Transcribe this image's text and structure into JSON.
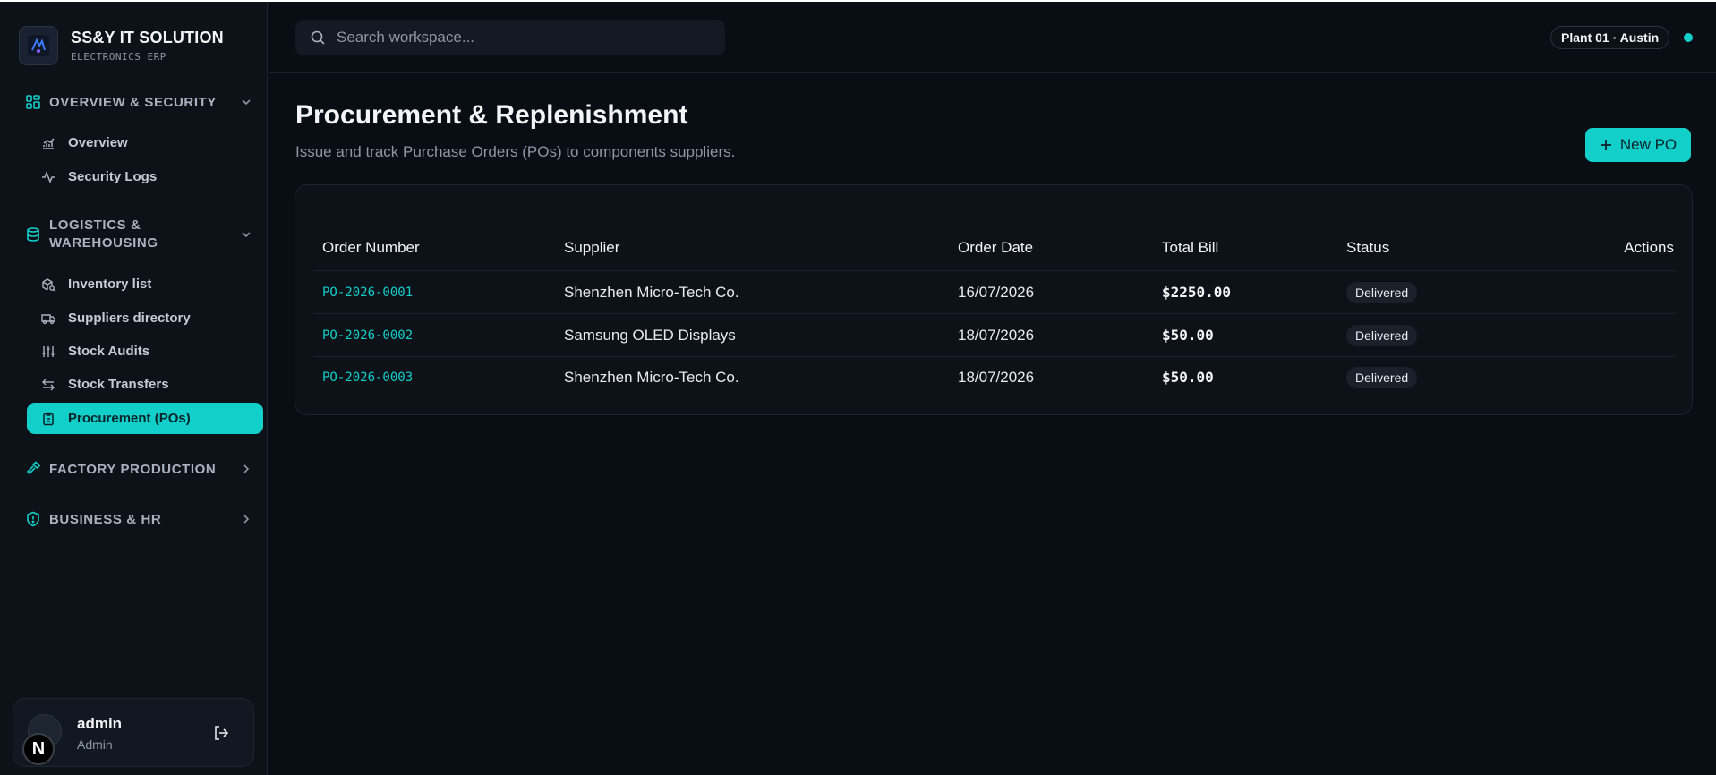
{
  "brand": {
    "title": "SS&Y IT SOLUTION",
    "subtitle": "ELECTRONICS ERP"
  },
  "sidebar": {
    "sections": [
      {
        "label": "OVERVIEW & SECURITY",
        "items": [
          {
            "label": "Overview"
          },
          {
            "label": "Security Logs"
          }
        ]
      },
      {
        "label_line1": "LOGISTICS &",
        "label_line2": "WAREHOUSING",
        "items": [
          {
            "label": "Inventory list"
          },
          {
            "label": "Suppliers directory"
          },
          {
            "label": "Stock Audits"
          },
          {
            "label": "Stock Transfers"
          },
          {
            "label": "Procurement (POs)",
            "active": true
          }
        ]
      },
      {
        "label": "FACTORY PRODUCTION"
      },
      {
        "label": "BUSINESS & HR"
      }
    ]
  },
  "user": {
    "name": "admin",
    "role": "Admin",
    "badge": "N"
  },
  "topbar": {
    "search_placeholder": "Search workspace...",
    "plant": "Plant 01 · Austin"
  },
  "page": {
    "title": "Procurement & Replenishment",
    "subtitle": "Issue and track Purchase Orders (POs) to components suppliers.",
    "new_button": "New PO"
  },
  "table": {
    "columns": [
      "Order Number",
      "Supplier",
      "Order Date",
      "Total Bill",
      "Status",
      "Actions"
    ],
    "rows": [
      {
        "order": "PO-2026-0001",
        "supplier": "Shenzhen Micro-Tech Co.",
        "date": "16/07/2026",
        "total": "$2250.00",
        "status": "Delivered"
      },
      {
        "order": "PO-2026-0002",
        "supplier": "Samsung OLED Displays",
        "date": "18/07/2026",
        "total": "$50.00",
        "status": "Delivered"
      },
      {
        "order": "PO-2026-0003",
        "supplier": "Shenzhen Micro-Tech Co.",
        "date": "18/07/2026",
        "total": "$50.00",
        "status": "Delivered"
      }
    ]
  },
  "colors": {
    "accent": "#13cfc9",
    "background": "#090d14",
    "sidebar": "#0d1219"
  }
}
